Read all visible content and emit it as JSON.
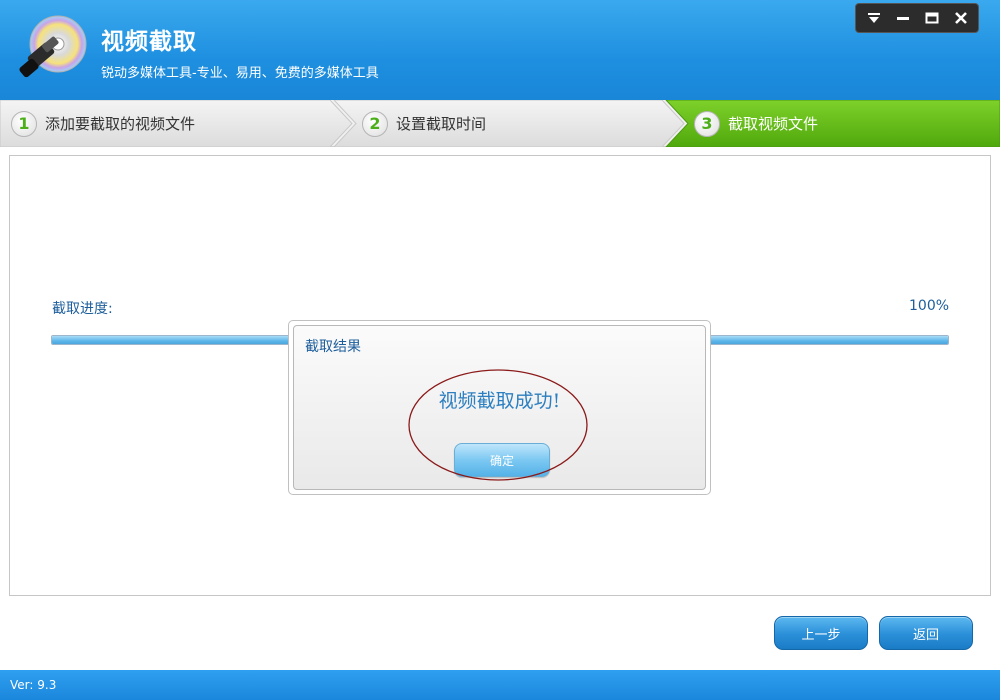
{
  "app": {
    "title": "视频截取",
    "subtitle": "锐动多媒体工具-专业、易用、免费的多媒体工具"
  },
  "window_controls": {
    "icons": [
      "dropdown-icon",
      "minimize-icon",
      "maximize-icon",
      "close-icon"
    ]
  },
  "steps": [
    {
      "number": "1",
      "label": "添加要截取的视频文件",
      "active": false
    },
    {
      "number": "2",
      "label": "设置截取时间",
      "active": false
    },
    {
      "number": "3",
      "label": "截取视频文件",
      "active": true
    }
  ],
  "progress": {
    "label": "截取进度:",
    "percent_text": "100%",
    "value": 1.0
  },
  "dialog": {
    "title": "截取结果",
    "message": "视频截取成功!",
    "ok_label": "确定"
  },
  "nav": {
    "prev_label": "上一步",
    "back_label": "返回"
  },
  "status": {
    "version": "Ver: 9.3"
  },
  "colors": {
    "header_blue": "#1e8fe0",
    "active_step_green": "#5dbb14",
    "text_blue": "#1d5e9b",
    "highlight_red": "#8b1a1a"
  }
}
